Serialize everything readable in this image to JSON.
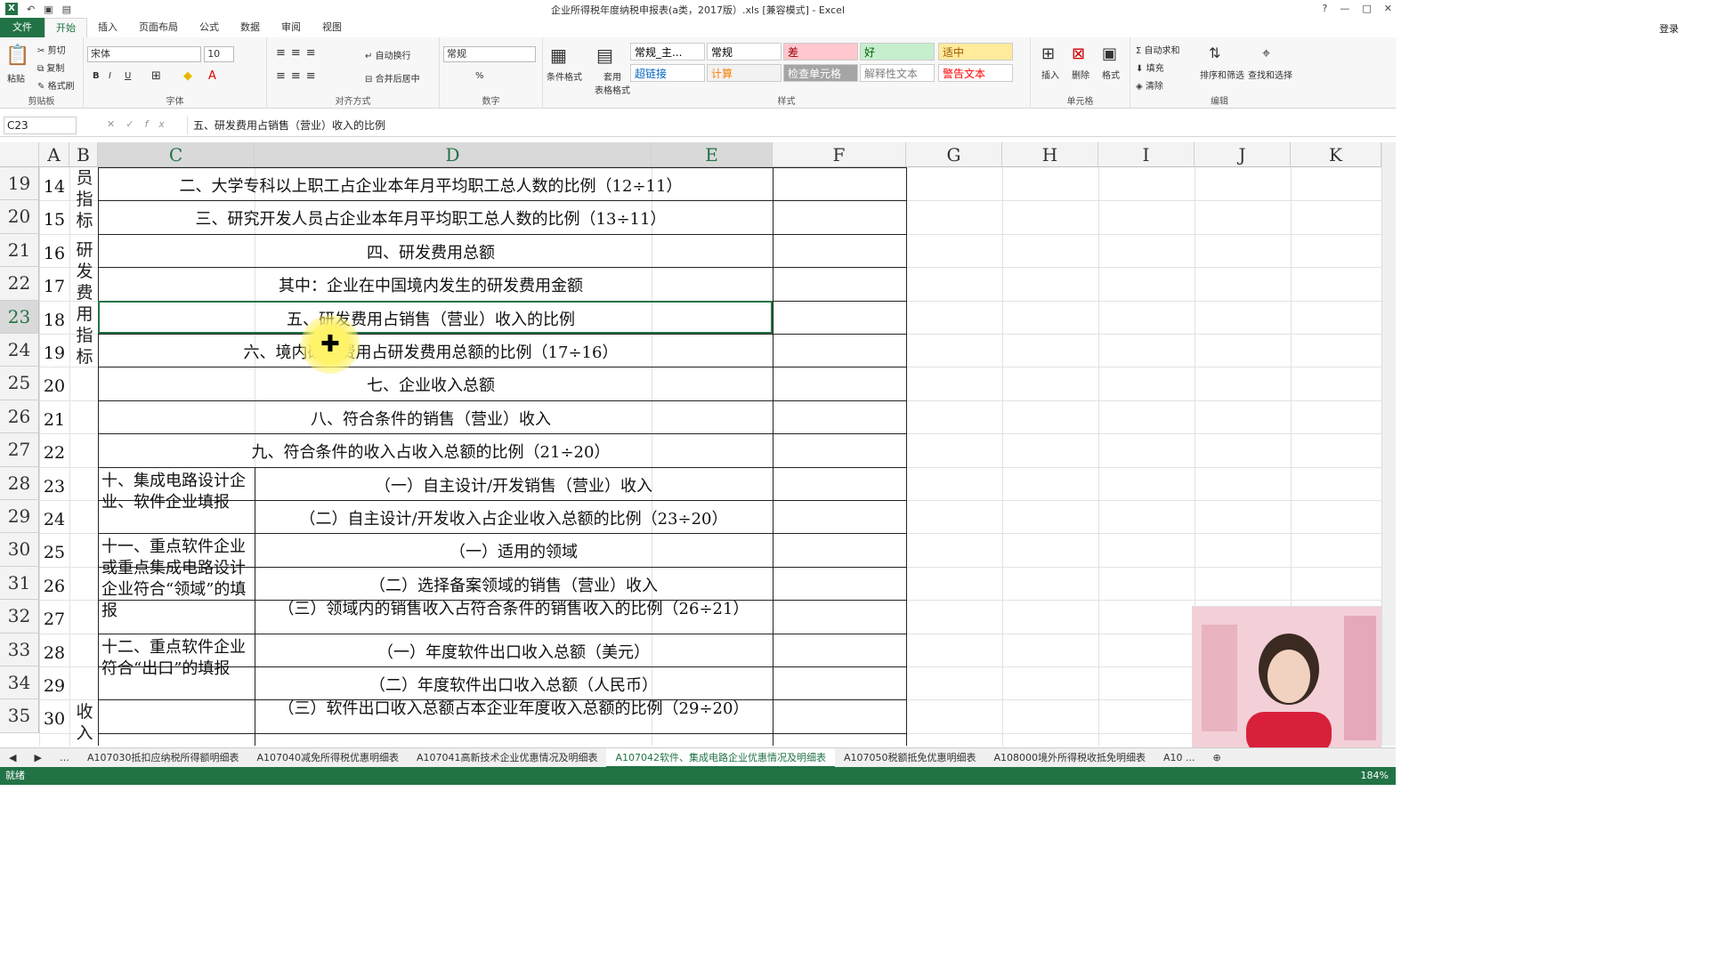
{
  "window": {
    "title": "企业所得税年度纳税申报表(a类，2017版）.xls [兼容模式] - Excel",
    "help": "?",
    "controls": [
      "—",
      "□",
      "✕"
    ]
  },
  "ribbon_tabs": [
    "文件",
    "开始",
    "插入",
    "页面布局",
    "公式",
    "数据",
    "审阅",
    "视图"
  ],
  "login": "登录",
  "ribbon": {
    "clipboard": {
      "label": "剪贴板",
      "paste": "粘贴",
      "cut": "剪切",
      "copy": "复制",
      "format_painter": "格式刷"
    },
    "font": {
      "label": "字体",
      "name": "宋体",
      "size": "10",
      "bold": "B",
      "italic": "I",
      "underline": "U"
    },
    "align": {
      "label": "对齐方式",
      "wrap": "自动换行",
      "merge": "合并后居中"
    },
    "number": {
      "label": "数字",
      "format": "常规",
      "percent": "%"
    },
    "styles": {
      "label": "样式",
      "cond": "条件格式",
      "table": "套用\n表格格式",
      "items": [
        {
          "t": "常规_主...",
          "bg": "#ffffff",
          "c": "#000000"
        },
        {
          "t": "常规",
          "bg": "#ffffff",
          "c": "#000000"
        },
        {
          "t": "差",
          "bg": "#ffc7ce",
          "c": "#9c0006"
        },
        {
          "t": "好",
          "bg": "#c6efce",
          "c": "#006100"
        },
        {
          "t": "适中",
          "bg": "#ffeb9c",
          "c": "#9c5700"
        },
        {
          "t": "超链接",
          "bg": "#ffffff",
          "c": "#0563c1"
        },
        {
          "t": "计算",
          "bg": "#f2f2f2",
          "c": "#fa7d00"
        },
        {
          "t": "检查单元格",
          "bg": "#a5a5a5",
          "c": "#ffffff"
        },
        {
          "t": "解释性文本",
          "bg": "#ffffff",
          "c": "#7f7f7f"
        },
        {
          "t": "警告文本",
          "bg": "#ffffff",
          "c": "#ff0000"
        }
      ]
    },
    "cells": {
      "label": "单元格",
      "insert": "插入",
      "delete": "删除",
      "format": "格式"
    },
    "editing": {
      "label": "编辑",
      "autosum": "自动求和",
      "fill": "填充",
      "clear": "清除",
      "sort": "排序和筛选",
      "find": "查找和选择"
    }
  },
  "formula_bar": {
    "name_box": "C23",
    "formula": "五、研发费用占销售（营业）收入的比例"
  },
  "columns": [
    "A",
    "B",
    "C",
    "D",
    "E",
    "F",
    "G",
    "H",
    "I",
    "J",
    "K"
  ],
  "rows": [
    {
      "r": "19",
      "a": "14",
      "text": "二、大学专科以上职工占企业本年月平均职工总人数的比例（12÷11）"
    },
    {
      "r": "20",
      "a": "15",
      "text": "三、研究开发人员占企业本年月平均职工总人数的比例（13÷11）"
    },
    {
      "r": "21",
      "a": "16",
      "text": "四、研发费用总额"
    },
    {
      "r": "22",
      "a": "17",
      "text": "其中：企业在中国境内发生的研发费用金额"
    },
    {
      "r": "23",
      "a": "18",
      "text": "五、研发费用占销售（营业）收入的比例"
    },
    {
      "r": "24",
      "a": "19",
      "text": "六、境内研发费用占研发费用总额的比例（17÷16）"
    },
    {
      "r": "25",
      "a": "20",
      "text": "七、企业收入总额"
    },
    {
      "r": "26",
      "a": "21",
      "text": "八、符合条件的销售（营业）收入"
    },
    {
      "r": "27",
      "a": "22",
      "text": "九、符合条件的收入占收入总额的比例（21÷20）"
    },
    {
      "r": "28",
      "a": "23",
      "text": "（一）自主设计/开发销售（营业）收入"
    },
    {
      "r": "29",
      "a": "24",
      "text": "（二）自主设计/开发收入占企业收入总额的比例（23÷20）"
    },
    {
      "r": "30",
      "a": "25",
      "text": "（一）适用的领域"
    },
    {
      "r": "31",
      "a": "26",
      "text": "（二）选择备案领域的销售（营业）收入"
    },
    {
      "r": "32",
      "a": "27",
      "text": "（三）领域内的销售收入占符合条件的销售收入的比例（26÷21）"
    },
    {
      "r": "33",
      "a": "28",
      "text": "（一）年度软件出口收入总额（美元）"
    },
    {
      "r": "34",
      "a": "29",
      "text": "（二）年度软件出口收入总额（人民币）"
    },
    {
      "r": "35",
      "a": "30",
      "text": "（三）软件出口收入总额占本企业年度收入总额的比例（29÷20）"
    }
  ],
  "col_b_labels": {
    "top": "员指标",
    "rd": "研发费用指标",
    "income": "收入指"
  },
  "merged_c": [
    {
      "text": "十、集成电路设计企业、软件企业填报"
    },
    {
      "text": "十一、重点软件企业或重点集成电路设计企业符合“领域”的填报"
    },
    {
      "text": "十二、重点软件企业符合“出口”的填报"
    }
  ],
  "sheet_tabs": [
    "A107030抵扣应纳税所得额明细表",
    "A107040减免所得税优惠明细表",
    "A107041高新技术企业优惠情况及明细表",
    "A107042软件、集成电路企业优惠情况及明细表",
    "A107050税额抵免优惠明细表",
    "A108000境外所得税收抵免明细表",
    "A10 ..."
  ],
  "active_sheet_index": 3,
  "status": {
    "ready": "就绪",
    "zoom": "184%"
  }
}
